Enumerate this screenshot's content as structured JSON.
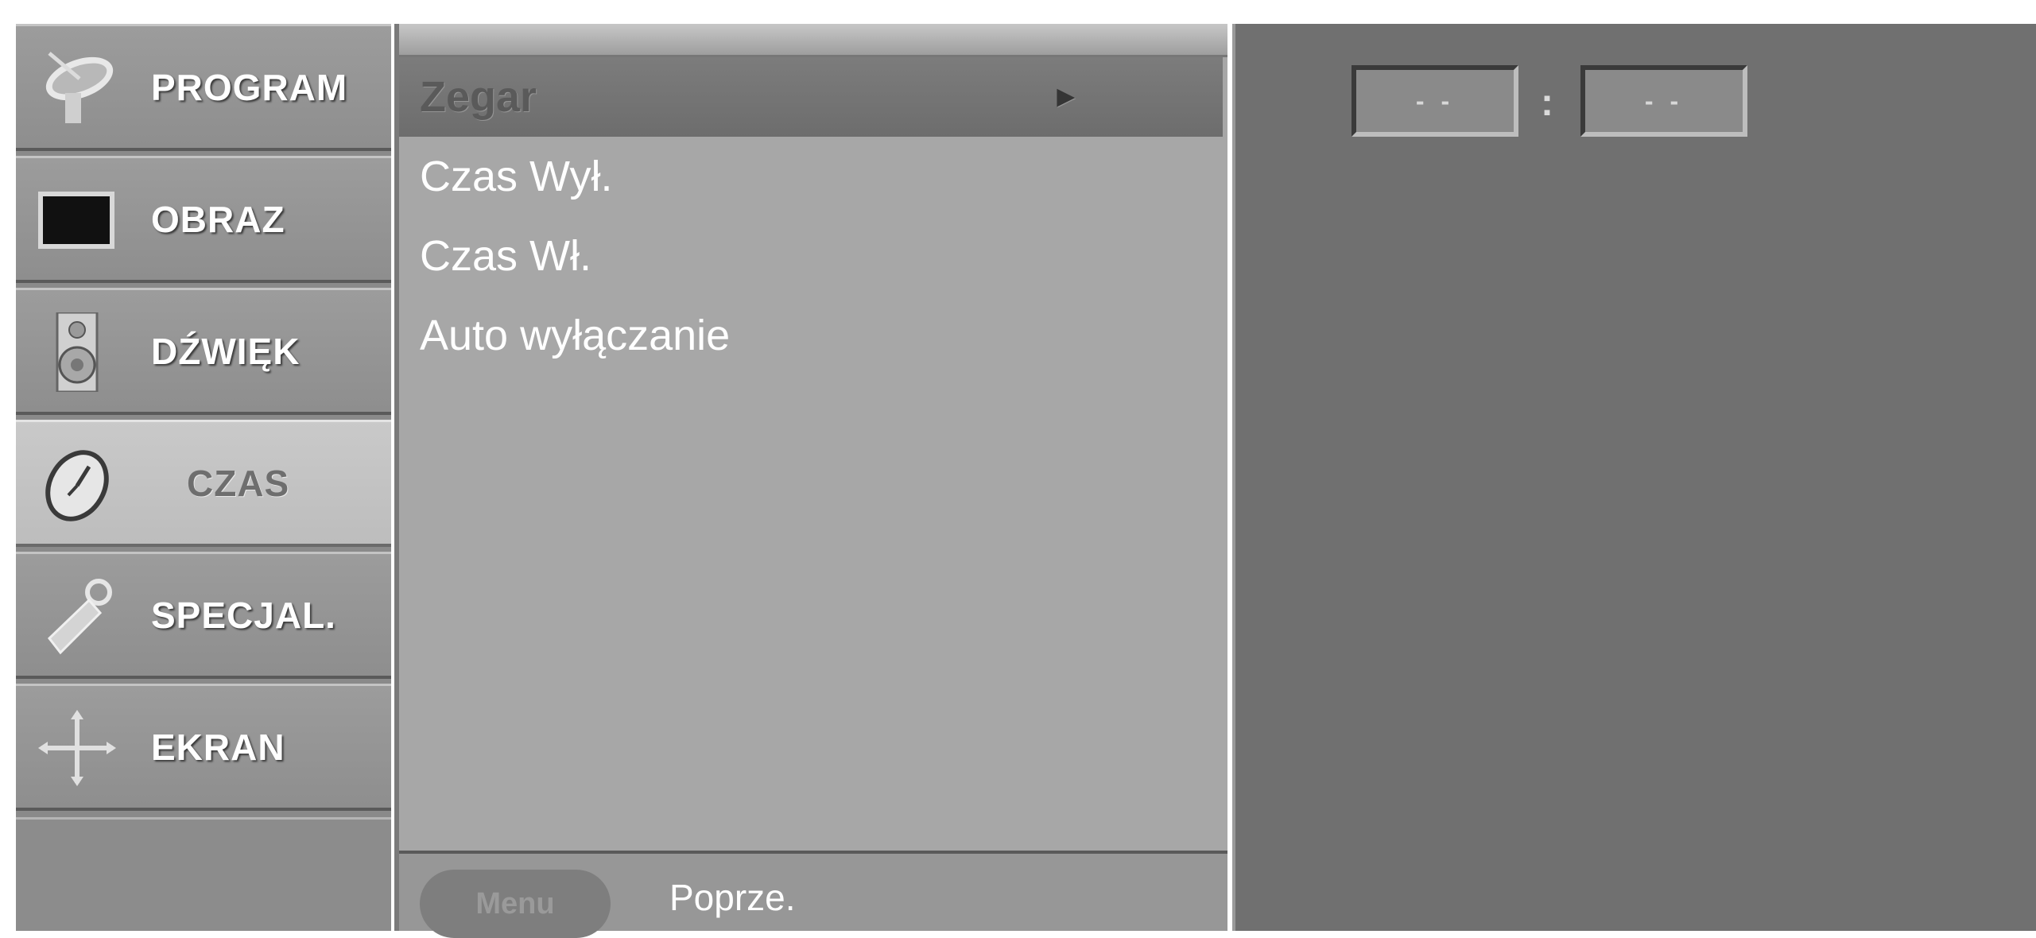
{
  "categories": [
    {
      "label": "PROGRAM",
      "icon": "satellite-dish-icon",
      "active": false
    },
    {
      "label": "OBRAZ",
      "icon": "tv-screen-icon",
      "active": false
    },
    {
      "label": "DŹWIĘK",
      "icon": "speaker-icon",
      "active": false
    },
    {
      "label": "CZAS",
      "icon": "clock-icon",
      "active": true
    },
    {
      "label": "SPECJAL.",
      "icon": "key-tag-icon",
      "active": false
    },
    {
      "label": "EKRAN",
      "icon": "move-arrows-icon",
      "active": false
    }
  ],
  "submenu": {
    "items": [
      {
        "label": "Zegar",
        "selected": true,
        "arrow": "►"
      },
      {
        "label": "Czas Wył.",
        "selected": false
      },
      {
        "label": "Czas Wł.",
        "selected": false
      },
      {
        "label": "Auto wyłączanie",
        "selected": false
      }
    ],
    "footer": {
      "menu_button": "Menu",
      "hint": "Poprze."
    }
  },
  "clock": {
    "hours": "- -",
    "separator": ":",
    "minutes": "- -"
  }
}
